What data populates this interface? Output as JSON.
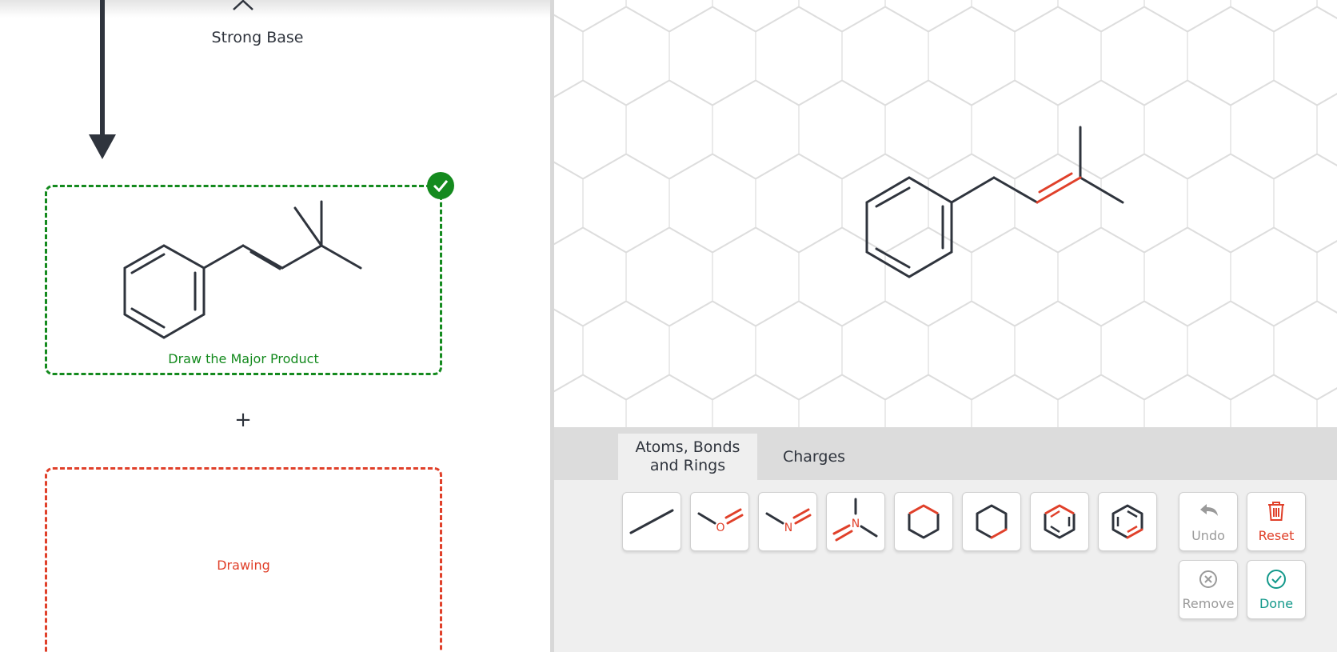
{
  "reaction": {
    "reagent": "Strong Base"
  },
  "answer_boxes": [
    {
      "label": "Draw the Major Product",
      "status": "correct"
    },
    {
      "label": "Drawing",
      "status": "incomplete"
    }
  ],
  "plus_sign": "+",
  "editor": {
    "tabs": [
      {
        "label": "Atoms, Bonds and Rings",
        "active": true
      },
      {
        "label": "Charges",
        "active": false
      }
    ],
    "tools": [
      {
        "name": "single-bond",
        "glyph": ""
      },
      {
        "name": "oxygen-double-bond",
        "glyph": "O"
      },
      {
        "name": "nitrogen-double-bond",
        "glyph": "N"
      },
      {
        "name": "nitrogen-branched",
        "glyph": "N"
      },
      {
        "name": "cyclohexane-top",
        "glyph": ""
      },
      {
        "name": "cyclohexane-bottom",
        "glyph": ""
      },
      {
        "name": "benzene-top",
        "glyph": ""
      },
      {
        "name": "benzene-bottom",
        "glyph": ""
      }
    ],
    "actions": {
      "undo": {
        "label": "Undo",
        "enabled": false,
        "icon": "undo-icon"
      },
      "reset": {
        "label": "Reset",
        "enabled": true,
        "icon": "trash-icon"
      },
      "remove": {
        "label": "Remove",
        "enabled": false,
        "icon": "remove-icon"
      },
      "done": {
        "label": "Done",
        "enabled": true,
        "icon": "check-circle-icon"
      }
    }
  },
  "colors": {
    "correct": "#148a1e",
    "error": "#e0402a",
    "bond": "#2f343d",
    "highlight_bond": "#e0402a",
    "grid": "#dddddd",
    "done": "#12988a"
  }
}
